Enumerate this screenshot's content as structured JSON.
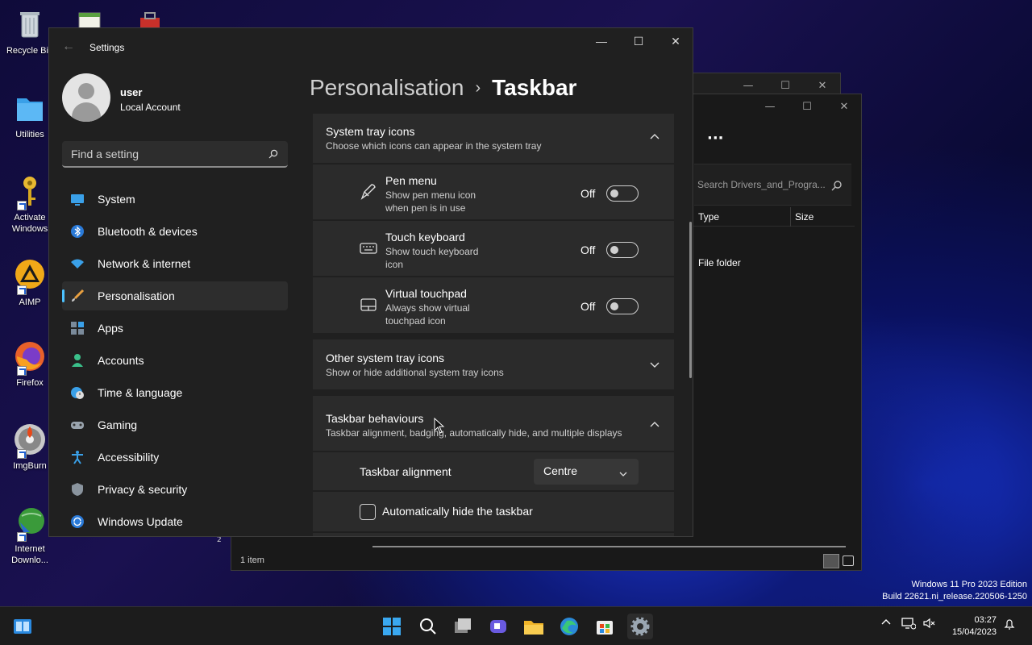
{
  "desktop": {
    "icons": [
      {
        "label": "Recycle Bin"
      },
      {
        "label": ""
      },
      {
        "label": ""
      },
      {
        "label": "Utilities"
      },
      {
        "label": "Activate Windows"
      },
      {
        "label": "AIMP"
      },
      {
        "label": "Firefox"
      },
      {
        "label": "ImgBurn"
      },
      {
        "label": "Internet Downlo..."
      }
    ],
    "watermark_line1": "Windows 11 Pro 2023 Edition",
    "watermark_line2": "Build 22621.ni_release.220506-1250"
  },
  "explorer": {
    "search_placeholder": "Search Drivers_and_Progra...",
    "more_label": "···",
    "col_type": "Type",
    "col_size": "Size",
    "row_type": "File folder",
    "status": "1 item",
    "page_badge": "2"
  },
  "settings": {
    "window_title": "Settings",
    "back_label": "←",
    "minimize_label": "—",
    "maximize_label": "☐",
    "close_label": "✕",
    "user_name": "user",
    "account_type": "Local Account",
    "search_placeholder": "Find a setting",
    "nav": [
      {
        "label": "System",
        "icon": "monitor-icon"
      },
      {
        "label": "Bluetooth & devices",
        "icon": "bluetooth-icon"
      },
      {
        "label": "Network & internet",
        "icon": "wifi-icon"
      },
      {
        "label": "Personalisation",
        "icon": "brush-icon"
      },
      {
        "label": "Apps",
        "icon": "apps-icon"
      },
      {
        "label": "Accounts",
        "icon": "person-icon"
      },
      {
        "label": "Time & language",
        "icon": "globe-clock-icon"
      },
      {
        "label": "Gaming",
        "icon": "gamepad-icon"
      },
      {
        "label": "Accessibility",
        "icon": "accessibility-icon"
      },
      {
        "label": "Privacy & security",
        "icon": "shield-icon"
      },
      {
        "label": "Windows Update",
        "icon": "update-icon"
      }
    ],
    "breadcrumb_parent": "Personalisation",
    "breadcrumb_sep": "›",
    "breadcrumb_current": "Taskbar",
    "system_tray": {
      "title": "System tray icons",
      "desc": "Choose which icons can appear in the system tray",
      "items": [
        {
          "title": "Pen menu",
          "desc": "Show pen menu icon when pen is in use",
          "state": "Off"
        },
        {
          "title": "Touch keyboard",
          "desc": "Show touch keyboard icon",
          "state": "Off"
        },
        {
          "title": "Virtual touchpad",
          "desc": "Always show virtual touchpad icon",
          "state": "Off"
        }
      ]
    },
    "other_tray": {
      "title": "Other system tray icons",
      "desc": "Show or hide additional system tray icons"
    },
    "behaviours": {
      "title": "Taskbar behaviours",
      "desc": "Taskbar alignment, badging, automatically hide, and multiple displays",
      "alignment_label": "Taskbar alignment",
      "alignment_value": "Centre",
      "autohide_label": "Automatically hide the taskbar"
    }
  },
  "taskbar": {
    "time": "03:27",
    "date": "15/04/2023"
  }
}
